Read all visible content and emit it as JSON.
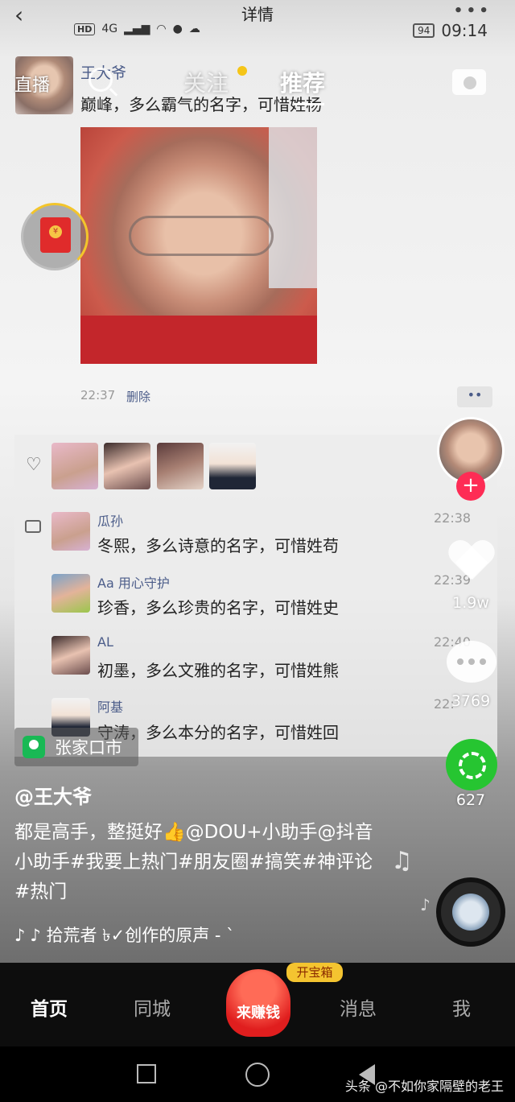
{
  "titlebar": {
    "title": "详情",
    "back_glyph": "‹",
    "more_glyph": "∙∙∙"
  },
  "statusbar": {
    "network_labels": [
      "HD",
      "4G"
    ],
    "battery": "94",
    "time": "09:14"
  },
  "topnav": {
    "live": "直播",
    "tabs": [
      "关注",
      "推荐"
    ],
    "active_tab": "推荐"
  },
  "post": {
    "author": "王大爷",
    "text": "巅峰，多么霸气的名字，可惜姓杨",
    "time": "22:37",
    "delete_label": "删除",
    "more_glyph": "••"
  },
  "comments": [
    {
      "name": "瓜孙",
      "time": "22:38",
      "text": "冬熙，多么诗意的名字，可惜姓苟"
    },
    {
      "name": "Aa 用心守护",
      "time": "22:39",
      "text": "珍香，多么珍贵的名字，可惜姓史"
    },
    {
      "name": "AL",
      "time": "22:40",
      "text": "初墨，多么文雅的名字，可惜姓熊"
    },
    {
      "name": "阿基",
      "time": "22:",
      "text": "守涛，多么本分的名字，可惜姓回"
    }
  ],
  "rail": {
    "like_count": "1.9w",
    "comment_count": "3769",
    "share_count": "627",
    "plus_glyph": "+"
  },
  "video": {
    "location": "张家口市",
    "author": "@王大爷",
    "caption": "都是高手，整挺好👍@DOU+小助手@抖音小助手#我要上热门#朋友圈#搞笑#神评论#热门",
    "music": "♪ 拾荒者 ৳✓创作的原声 - `"
  },
  "bottomnav": {
    "items": [
      "首页",
      "同城",
      "消息",
      "我"
    ],
    "earn_badge": "开宝箱",
    "earn_label": "来赚钱"
  },
  "watermark": "头条 @不如你家隔壁的老王",
  "colors": {
    "accent": "#fe2c55",
    "link": "#4b5c89",
    "share": "#26c531"
  }
}
